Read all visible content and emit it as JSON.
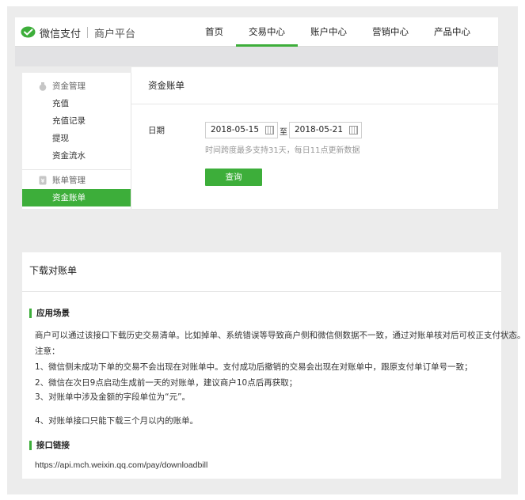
{
  "header": {
    "brand": "微信支付",
    "platform": "商户平台",
    "nav": [
      {
        "label": "首页",
        "active": false
      },
      {
        "label": "交易中心",
        "active": true
      },
      {
        "label": "账户中心",
        "active": false
      },
      {
        "label": "营销中心",
        "active": false
      },
      {
        "label": "产品中心",
        "active": false
      }
    ]
  },
  "sidebar": {
    "group1": "资金管理",
    "group1_items": [
      "充值",
      "充值记录",
      "提现",
      "资金流水"
    ],
    "group2": "账单管理",
    "group2_items": [
      "资金账单"
    ]
  },
  "main": {
    "title": "资金账单",
    "date_label": "日期",
    "start_date": "2018-05-15",
    "separator": "至",
    "end_date": "2018-05-21",
    "hint": "时间跨度最多支持31天，每日11点更新数据",
    "query_button": "查询"
  },
  "doc": {
    "title": "下载对账单",
    "section1": "应用场景",
    "lines": [
      "商户可以通过该接口下载历史交易清单。比如掉单、系统错误等导致商户侧和微信侧数据不一致，通过对账单核对后可校正支付状态。",
      "注意：",
      "1、微信侧未成功下单的交易不会出现在对账单中。支付成功后撤销的交易会出现在对账单中，跟原支付单订单号一致；",
      "2、微信在次日9点启动生成前一天的对账单，建议商户10点后再获取；",
      "3、对账单中涉及金额的字段单位为“元”。",
      "4、对账单接口只能下载三个月以内的账单。"
    ],
    "section2": "接口链接",
    "url": "https://api.mch.weixin.qq.com/pay/downloadbill"
  },
  "colors": {
    "accent": "#3dae3a",
    "background": "#ececec"
  }
}
